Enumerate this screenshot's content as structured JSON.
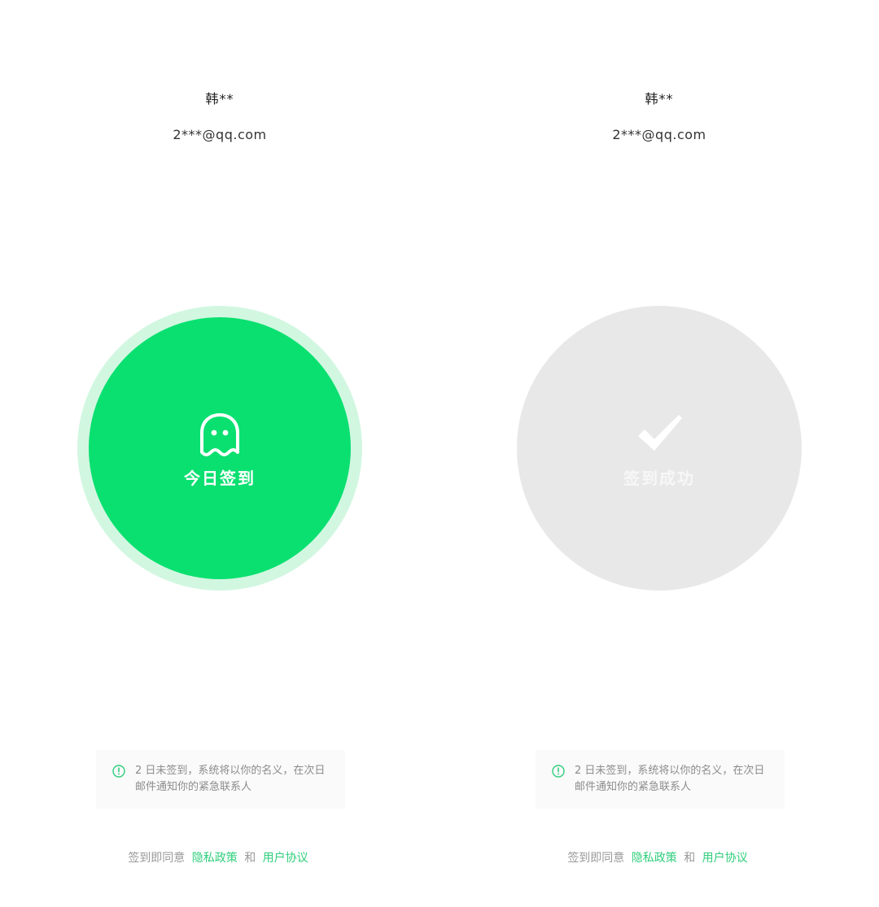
{
  "theme": {
    "primary_green": "#0ae070",
    "ring_green": "#d2f7e1",
    "success_gray": "#e8e8e8",
    "link_green": "#2fce7b"
  },
  "screens": [
    {
      "user_name": "韩**",
      "user_email": "2***@qq.com",
      "checkin_button": {
        "icon": "ghost-icon",
        "label": "今日签到",
        "state": "active"
      },
      "notice": {
        "icon": "info-icon",
        "text": "2 日未签到，系统将以你的名义，在次日邮件通知你的紧急联系人"
      },
      "agreement": {
        "prefix": "签到即同意",
        "privacy_link": "隐私政策",
        "and": "和",
        "terms_link": "用户协议"
      }
    },
    {
      "user_name": "韩**",
      "user_email": "2***@qq.com",
      "checkin_button": {
        "icon": "checkmark-icon",
        "label": "签到成功",
        "state": "done"
      },
      "notice": {
        "icon": "info-icon",
        "text": "2 日未签到，系统将以你的名义，在次日邮件通知你的紧急联系人"
      },
      "agreement": {
        "prefix": "签到即同意",
        "privacy_link": "隐私政策",
        "and": "和",
        "terms_link": "用户协议"
      }
    }
  ]
}
